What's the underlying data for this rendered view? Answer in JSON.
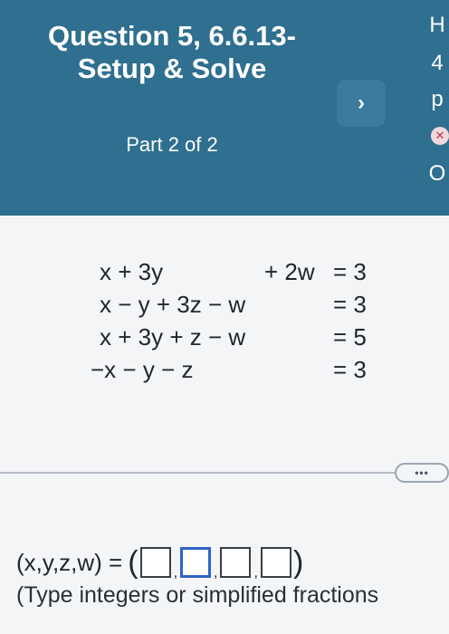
{
  "header": {
    "question_title": "Question 5, 6.6.13-Setup & Solve",
    "part_label": "Part 2 of 2",
    "next_icon_glyph": "›",
    "right_strip": [
      "H",
      "4",
      "p",
      "O"
    ]
  },
  "system": {
    "rows": [
      [
        "x + 3y",
        "+ 2w",
        "= 3"
      ],
      [
        "x − y + 3z − w",
        "",
        "= 3"
      ],
      [
        "x + 3y + z − w",
        "",
        "= 5"
      ],
      [
        "−x − y − z",
        "",
        "= 3"
      ]
    ]
  },
  "more_button": {
    "label": "•••"
  },
  "answer": {
    "prefix": "(x,y,z,w) =",
    "open_paren": "(",
    "close_paren": ")",
    "separator": ",",
    "hint": "(Type integers or simplified fractions"
  },
  "colors": {
    "header_bg": "#2f6f8f",
    "active_box_border": "#2c64c8"
  }
}
